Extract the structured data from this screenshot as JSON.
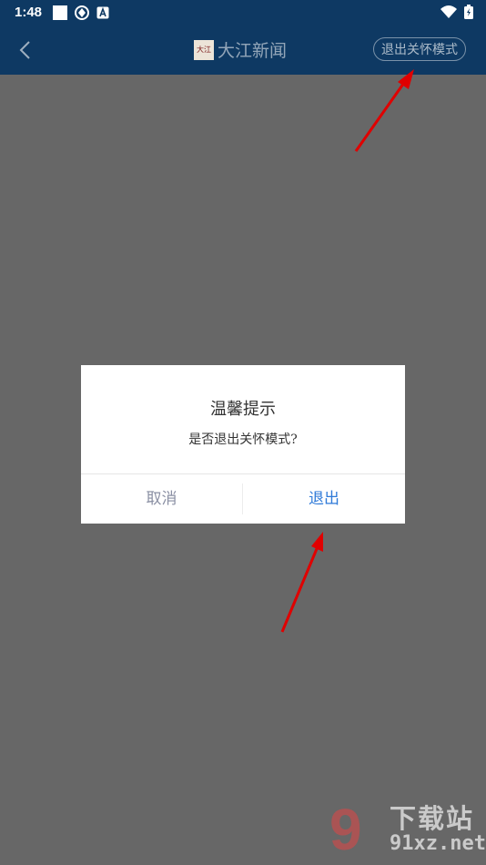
{
  "status_bar": {
    "time": "1:48"
  },
  "header": {
    "brand_logo_text": "大江",
    "brand_title": "大江新闻",
    "exit_care_label": "退出关怀模式"
  },
  "dialog": {
    "title": "温馨提示",
    "message": "是否退出关怀模式?",
    "cancel_label": "取消",
    "confirm_label": "退出"
  },
  "watermark": {
    "top": "下载站",
    "bottom": "91xz.net"
  },
  "colors": {
    "header_bg": "#0e3963",
    "overlay": "#676767",
    "confirm": "#2f7ad8",
    "cancel": "#8a8fa3",
    "annotation_arrow": "#e00000"
  }
}
